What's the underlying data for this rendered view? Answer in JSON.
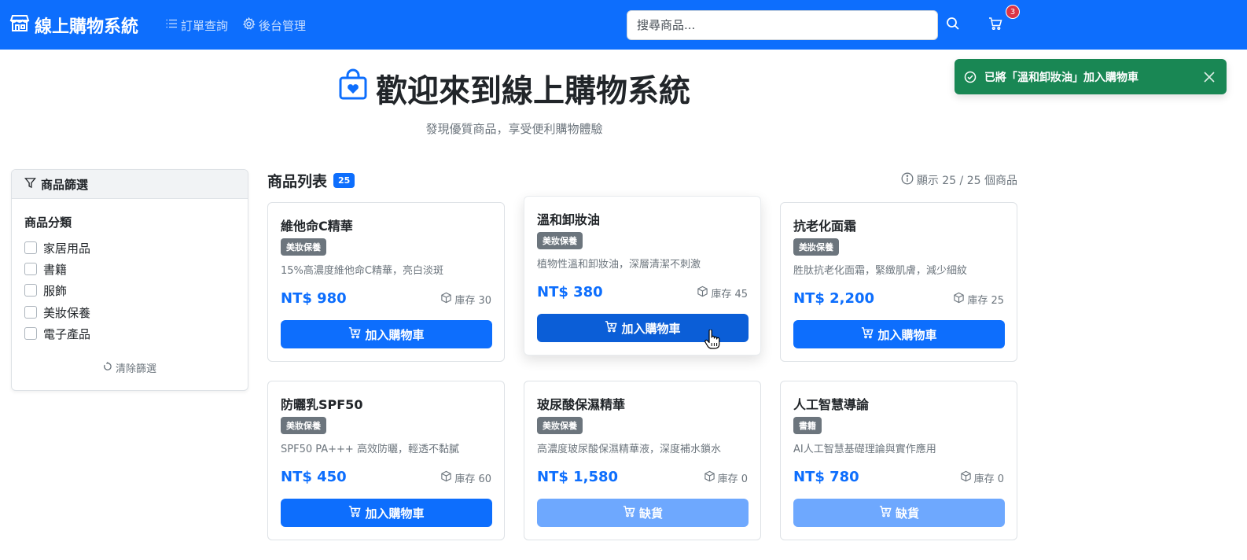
{
  "navbar": {
    "brand": "線上購物系統",
    "links": [
      {
        "label": "訂單查詢",
        "icon": "list-icon"
      },
      {
        "label": "後台管理",
        "icon": "gear-icon"
      }
    ],
    "search_placeholder": "搜尋商品...",
    "cart_count": "3"
  },
  "toast": {
    "message": "已將「溫和卸妝油」加入購物車",
    "color": "#198754"
  },
  "hero": {
    "title": "歡迎來到線上購物系統",
    "subtitle": "發現優質商品，享受便利購物體驗"
  },
  "sidebar": {
    "header": "商品篩選",
    "category_title": "商品分類",
    "categories": [
      "家居用品",
      "書籍",
      "服飾",
      "美妝保養",
      "電子產品"
    ],
    "clear_label": "清除篩選"
  },
  "products_header": {
    "title": "商品列表",
    "count_badge": "25",
    "showing": "顯示 25 / 25 個商品"
  },
  "products": [
    {
      "name": "維他命C精華",
      "category": "美妝保養",
      "description": "15%高濃度維他命C精華，亮白淡斑",
      "price": "NT$ 980",
      "stock": "庫存 30",
      "button": "加入購物車",
      "available": true
    },
    {
      "name": "溫和卸妝油",
      "category": "美妝保養",
      "description": "植物性溫和卸妝油，深層清潔不刺激",
      "price": "NT$ 380",
      "stock": "庫存 45",
      "button": "加入購物車",
      "available": true
    },
    {
      "name": "抗老化面霜",
      "category": "美妝保養",
      "description": "胜肽抗老化面霜，緊緻肌膚，減少細紋",
      "price": "NT$ 2,200",
      "stock": "庫存 25",
      "button": "加入購物車",
      "available": true
    },
    {
      "name": "防曬乳SPF50",
      "category": "美妝保養",
      "description": "SPF50 PA+++ 高效防曬，輕透不黏膩",
      "price": "NT$ 450",
      "stock": "庫存 60",
      "button": "加入購物車",
      "available": true
    },
    {
      "name": "玻尿酸保濕精華",
      "category": "美妝保養",
      "description": "高濃度玻尿酸保濕精華液，深度補水鎖水",
      "price": "NT$ 1,580",
      "stock": "庫存 0",
      "button": "缺貨",
      "available": false
    },
    {
      "name": "人工智慧導論",
      "category": "書籍",
      "description": "AI人工智慧基礎理論與實作應用",
      "price": "NT$ 780",
      "stock": "庫存 0",
      "button": "缺貨",
      "available": false
    }
  ],
  "colors": {
    "primary": "#0d6efd",
    "success": "#198754",
    "badge_gray": "#6c757d",
    "disabled_button": "#6ea8fe",
    "danger": "#dc3545"
  }
}
